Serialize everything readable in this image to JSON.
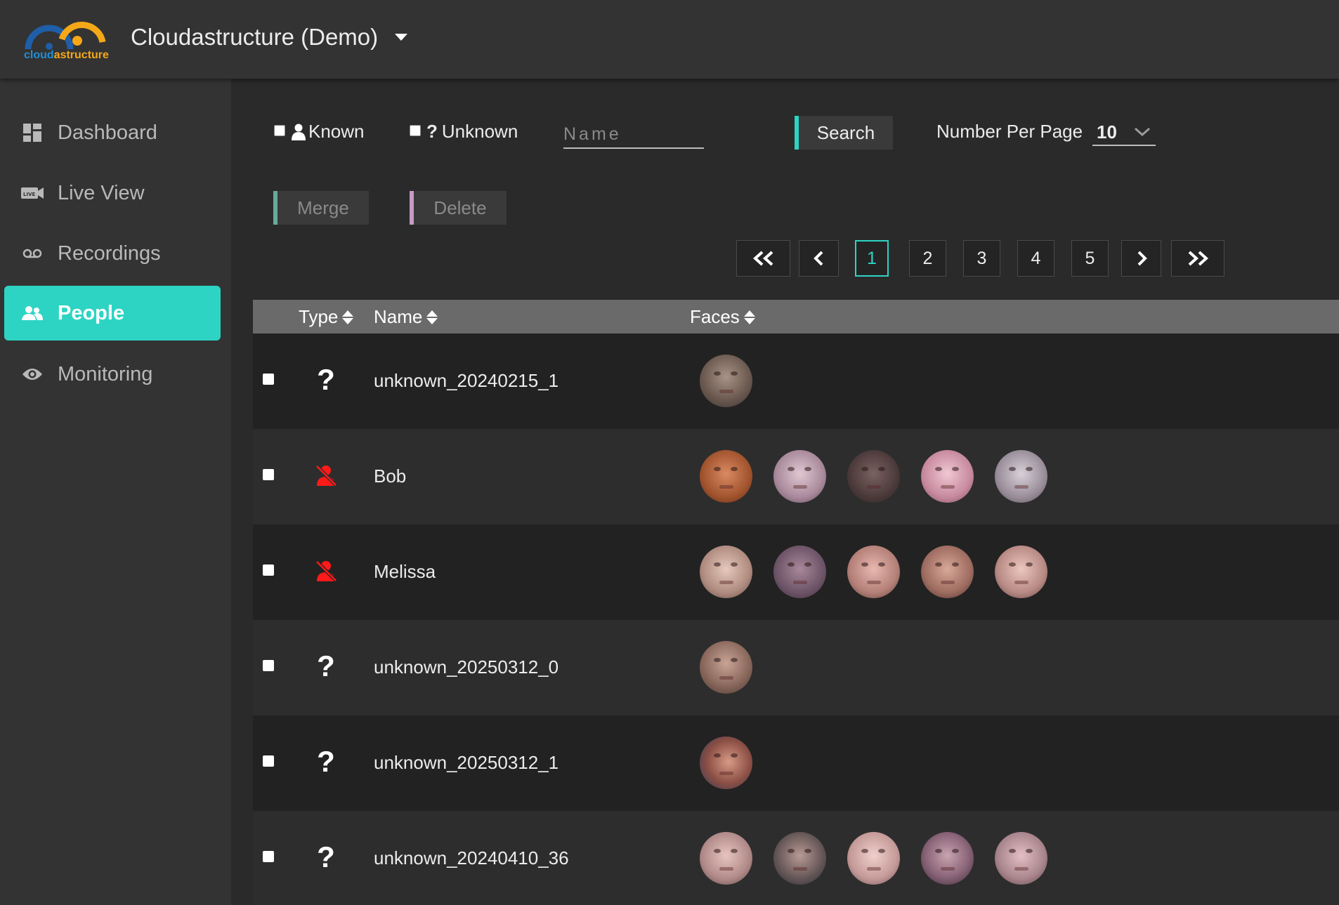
{
  "app": {
    "logo_text_part1": "cloud",
    "logo_text_part2": "astructure",
    "title": "Cloudastructure (Demo)"
  },
  "sidebar": {
    "items": [
      {
        "label": "Dashboard",
        "icon": "dashboard-icon"
      },
      {
        "label": "Live View",
        "icon": "live-camera-icon"
      },
      {
        "label": "Recordings",
        "icon": "voicemail-icon"
      },
      {
        "label": "People",
        "icon": "people-icon",
        "active": true
      },
      {
        "label": "Monitoring",
        "icon": "eye-icon"
      }
    ]
  },
  "filters": {
    "known_label": "Known",
    "unknown_label": "Unknown",
    "name_placeholder": "Name",
    "search_label": "Search",
    "number_per_page_label": "Number Per Page",
    "number_per_page_value": "10"
  },
  "actions": {
    "merge_label": "Merge",
    "delete_label": "Delete"
  },
  "pagination": {
    "pages": [
      "1",
      "2",
      "3",
      "4",
      "5"
    ],
    "current": "1"
  },
  "table": {
    "columns": {
      "type": "Type",
      "name": "Name",
      "faces": "Faces"
    },
    "rows": [
      {
        "type": "unknown",
        "name": "unknown_20240215_1",
        "faces": 1
      },
      {
        "type": "known",
        "name": "Bob",
        "faces": 5
      },
      {
        "type": "known",
        "name": "Melissa",
        "faces": 5
      },
      {
        "type": "unknown",
        "name": "unknown_20250312_0",
        "faces": 1
      },
      {
        "type": "unknown",
        "name": "unknown_20250312_1",
        "faces": 1
      },
      {
        "type": "unknown",
        "name": "unknown_20240410_36",
        "faces": 5
      }
    ]
  },
  "colors": {
    "accent": "#2dd4c4",
    "known_icon": "#ff1a1a",
    "merge_border": "#6aa89d",
    "delete_border": "#c79ac4"
  }
}
